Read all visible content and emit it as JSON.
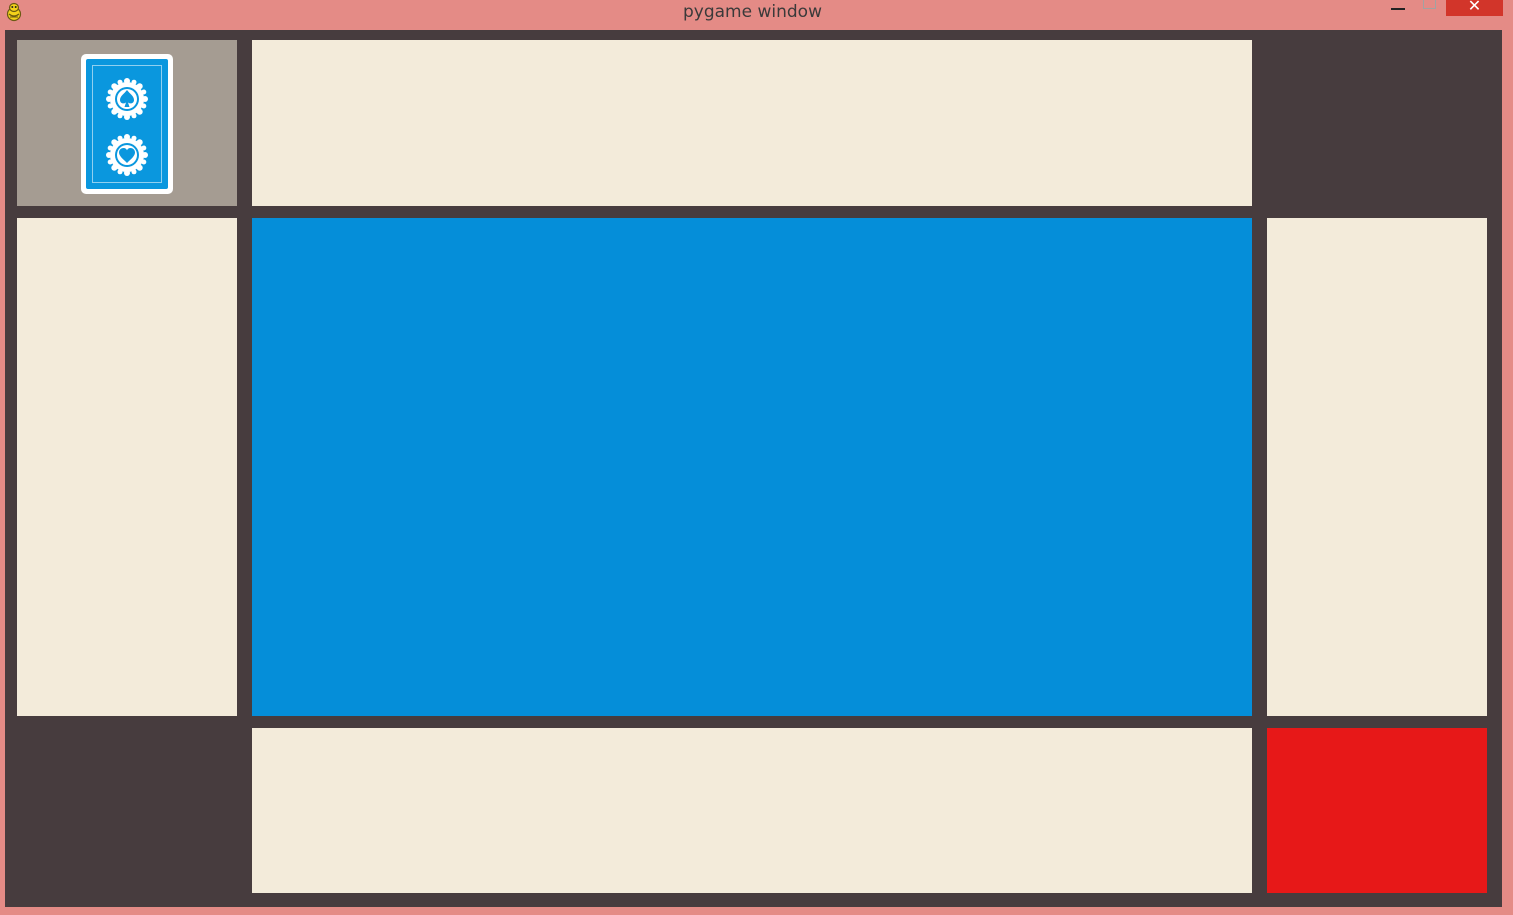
{
  "window": {
    "title": "pygame window",
    "close_glyph": "✕",
    "app_icon": "pygame-snake-icon",
    "minimize_icon": "minimize-icon",
    "maximize_icon": "maximize-icon"
  },
  "colors": {
    "title_bar": "#e48b86",
    "background": "#473c3e",
    "deck_panel": "#a59c92",
    "hand_panel": "#f3ebda",
    "table_center": "#058ed9",
    "action_button": "#e71818",
    "card_back": "#0a97de"
  },
  "board": {
    "deck": {
      "card_back_emblems": [
        "spade-emblem-icon",
        "heart-emblem-icon"
      ]
    },
    "panels": [
      "top-hand",
      "left-hand",
      "right-hand",
      "bottom-hand"
    ]
  }
}
